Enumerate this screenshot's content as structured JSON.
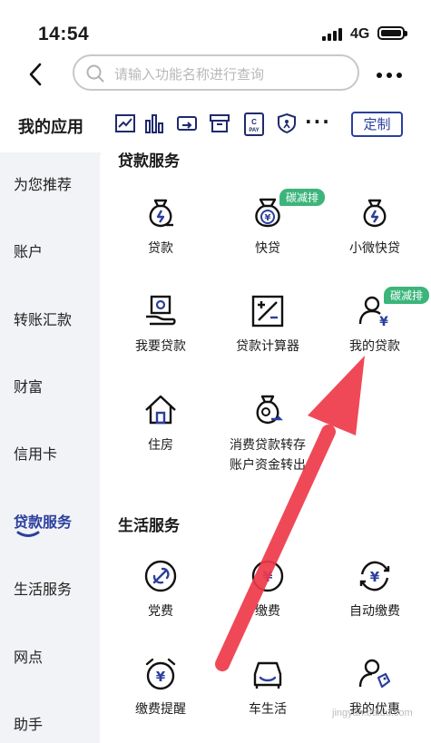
{
  "status": {
    "time": "14:54",
    "network": "4G"
  },
  "search": {
    "placeholder": "请输入功能名称进行查询"
  },
  "apps": {
    "title": "我的应用",
    "custom_label": "定制",
    "more": "···"
  },
  "sidebar": {
    "items": [
      {
        "label": "为您推荐"
      },
      {
        "label": "账户"
      },
      {
        "label": "转账汇款"
      },
      {
        "label": "财富"
      },
      {
        "label": "信用卡"
      },
      {
        "label": "贷款服务"
      },
      {
        "label": "生活服务"
      },
      {
        "label": "网点"
      },
      {
        "label": "助手"
      }
    ],
    "active_index": 5
  },
  "loan_section": {
    "title": "贷款服务",
    "tiles": [
      {
        "label": "贷款",
        "icon": "loan-bag-icon"
      },
      {
        "label": "快贷",
        "icon": "yuan-bag-icon",
        "badge": "碳减排"
      },
      {
        "label": "小微快贷",
        "icon": "loan-bag-icon"
      },
      {
        "label": "我要贷款",
        "icon": "hand-card-icon"
      },
      {
        "label": "贷款计算器",
        "icon": "calculator-icon"
      },
      {
        "label": "我的贷款",
        "icon": "user-yuan-icon",
        "badge": "碳减排"
      },
      {
        "label": "住房",
        "icon": "house-icon"
      },
      {
        "label": "消费贷款转存",
        "label2": "账户资金转出",
        "icon": "transfer-bag-icon"
      }
    ]
  },
  "life_section": {
    "title": "生活服务",
    "tiles": [
      {
        "label": "党费",
        "icon": "party-emblem-icon"
      },
      {
        "label": "缴费",
        "icon": "payment-icon"
      },
      {
        "label": "自动缴费",
        "icon": "auto-pay-icon"
      },
      {
        "label": "缴费提醒",
        "icon": "alarm-clock-icon"
      },
      {
        "label": "车生活",
        "icon": "car-icon"
      },
      {
        "label": "我的优惠",
        "icon": "user-coupon-icon"
      }
    ]
  },
  "watermark": "jingyan.baidu.com"
}
